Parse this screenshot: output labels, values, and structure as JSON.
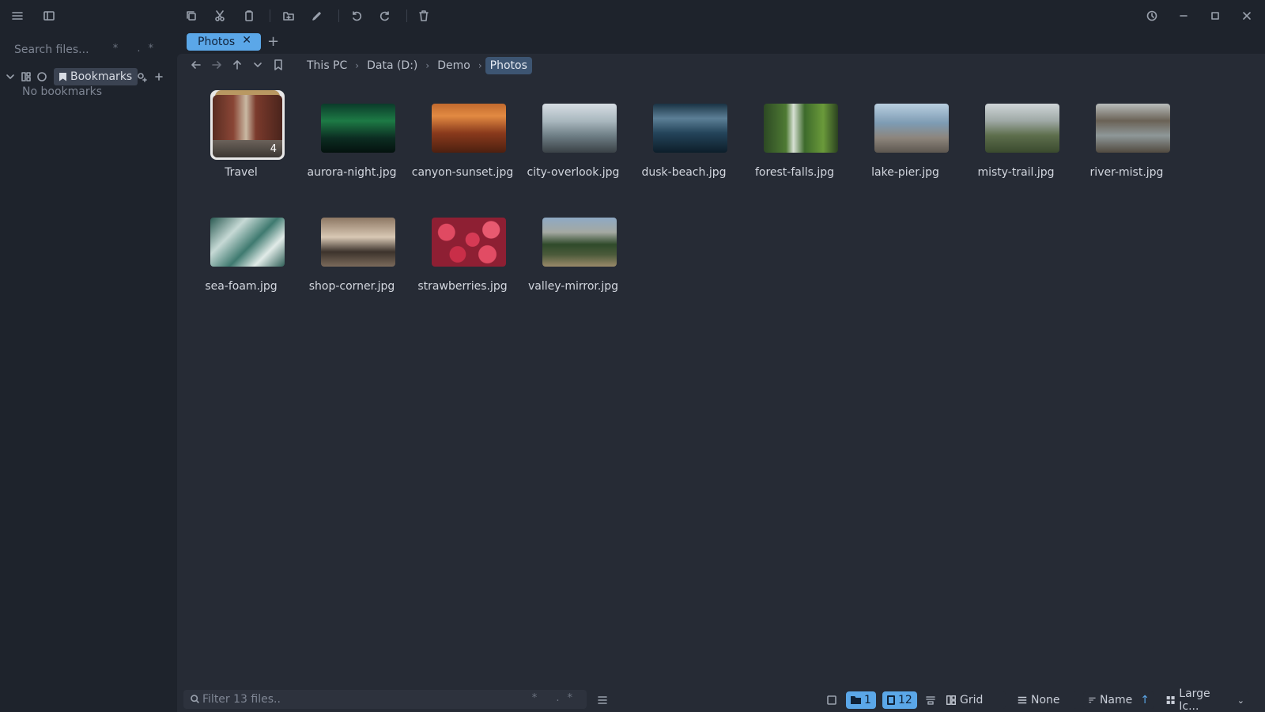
{
  "sidebar": {
    "search_placeholder": "Search files...",
    "search_mods": "* .*",
    "bookmarks_label": "Bookmarks",
    "no_bookmarks": "No bookmarks"
  },
  "tabs": [
    {
      "label": "Photos",
      "close": "✕"
    }
  ],
  "tab_add": "+",
  "breadcrumbs": [
    "This PC",
    "Data (D:)",
    "Demo",
    "Photos"
  ],
  "items": [
    {
      "name": "Travel",
      "kind": "folder",
      "badge": "4"
    },
    {
      "name": "aurora-night.jpg"
    },
    {
      "name": "canyon-sunset.jpg"
    },
    {
      "name": "city-overlook.jpg"
    },
    {
      "name": "dusk-beach.jpg"
    },
    {
      "name": "forest-falls.jpg"
    },
    {
      "name": "lake-pier.jpg"
    },
    {
      "name": "misty-trail.jpg"
    },
    {
      "name": "river-mist.jpg"
    },
    {
      "name": "sea-foam.jpg"
    },
    {
      "name": "shop-corner.jpg"
    },
    {
      "name": "strawberries.jpg"
    },
    {
      "name": "valley-mirror.jpg"
    }
  ],
  "status": {
    "filter_placeholder": "Filter 13 files..",
    "filter_mods": "* .*",
    "folders_count": "1",
    "files_count": "12",
    "layout": "Grid",
    "group": "None",
    "sort": "Name",
    "sort_dir": "↑",
    "view": "Large Ic..."
  },
  "colors": {
    "accent": "#5ba7e8",
    "background": "#1e232c",
    "content_bg": "#262b35"
  }
}
